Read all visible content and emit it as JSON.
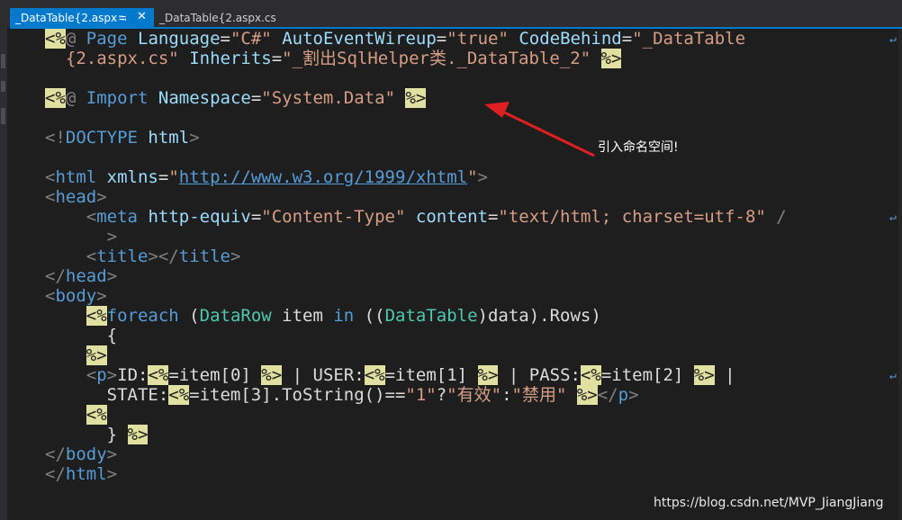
{
  "tabs": [
    {
      "label": "_DataTable{2.aspx",
      "pin": "⭾",
      "close": "✕"
    },
    {
      "label": "_DataTable{2.aspx.cs"
    }
  ],
  "code": {
    "l1": {
      "open": "<%",
      "at": "@",
      "page": "Page",
      "a1": "Language",
      "eq": "=",
      "v1": "\"C#\"",
      "a2": "AutoEventWireup",
      "v2": "\"true\"",
      "a3": "CodeBehind",
      "v3a": "\"_DataTable"
    },
    "l2": {
      "v3b": "{2.aspx.cs\"",
      "a4": "Inherits",
      "v4": "\"_割出SqlHelper类._DataTable_2\"",
      "close": "%>"
    },
    "l3": {
      "open": "<%",
      "at": "@",
      "import": "Import",
      "a1": "Namespace",
      "v1": "\"System.Data\"",
      "close": "%>"
    },
    "l4": {
      "lt": "<!",
      "doctype": "DOCTYPE",
      "html": "html",
      "gt": ">"
    },
    "l5": {
      "lt": "<",
      "tag": "html",
      "attr": "xmlns",
      "q1": "\"",
      "link": "http://www.w3.org/1999/xhtml",
      "q2": "\"",
      "gt": ">"
    },
    "l6": {
      "lt": "<",
      "tag": "head",
      "gt": ">"
    },
    "l7": {
      "lt": "<",
      "tag": "meta",
      "a1": "http-equiv",
      "v1": "\"Content-Type\"",
      "a2": "content",
      "v2": "\"text/html; charset=utf-8\"",
      "tail": "/"
    },
    "l8": {
      "gt": ">"
    },
    "l9": {
      "lt": "<",
      "tag": "title",
      "mid": "></",
      "tag2": "title",
      "gt": ">"
    },
    "l10": {
      "lt": "</",
      "tag": "head",
      "gt": ">"
    },
    "l11": {
      "lt": "<",
      "tag": "body",
      "gt": ">"
    },
    "l12": {
      "open": "<%",
      "kw": "foreach",
      "p1": " (",
      "type1": "DataRow",
      "item": " item ",
      "in": "in",
      "p2": " ((",
      "type2": "DataTable",
      "rest": ")data).Rows)"
    },
    "l13": {
      "brace": "{"
    },
    "l14": {
      "close": "%>"
    },
    "l15": {
      "lt": "<",
      "tag": "p",
      "gt": ">",
      "t1": "ID:",
      "o1": "<%",
      "e1": "=item[0] ",
      "c1": "%>",
      "t2": " | USER:",
      "o2": "<%",
      "e2": "=item[1] ",
      "c2": "%>",
      "t3": " | PASS:",
      "o3": "<%",
      "e3": "=item[2] ",
      "c3": "%>",
      "t4": " |"
    },
    "l16": {
      "t1": "STATE:",
      "o1": "<%",
      "e1": "=item[3].ToString()==",
      "s1": "\"1\"",
      "q": "?",
      "s2": "\"有效\"",
      "colon": ":",
      "s3": "\"禁用\"",
      "sp": " ",
      "c1": "%>",
      "lt": "</",
      "tag": "p",
      "gt": ">"
    },
    "l17": {
      "open": "<%"
    },
    "l18": {
      "brace": "} ",
      "close": "%>"
    },
    "l19": {
      "lt": "</",
      "tag": "body",
      "gt": ">"
    },
    "l20": {
      "lt": "</",
      "tag": "html",
      "gt": ">"
    },
    "wrap_glyph": "↵"
  },
  "annotation": {
    "text": "引入命名空间!"
  },
  "watermark": {
    "text": "https://blog.csdn.net/MVP_JiangJiang"
  },
  "colors": {
    "background": "#1e1e1e",
    "tab_active": "#007acc",
    "keyword": "#569cd6",
    "attribute": "#9cdcfe",
    "string": "#d69d85",
    "type": "#4ec9b0",
    "server_tag_highlight": "#e0e0a0",
    "annotation_arrow": "#e02020"
  }
}
